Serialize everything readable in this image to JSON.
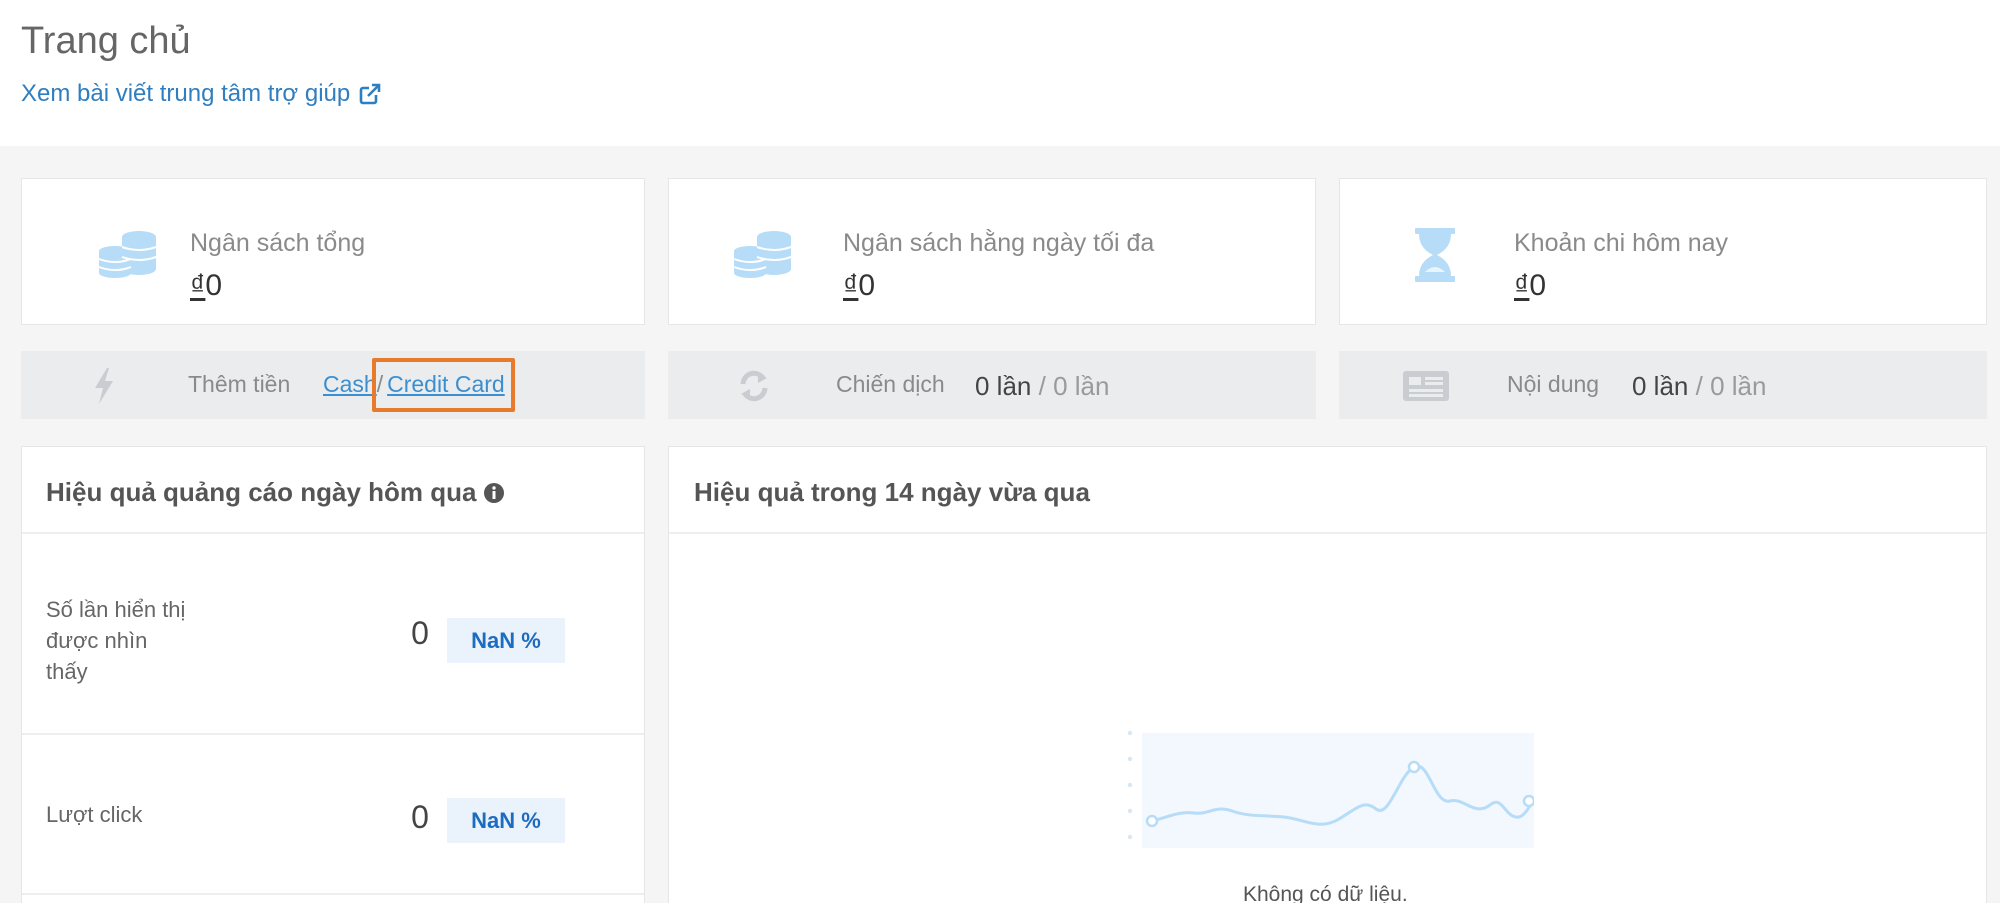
{
  "header": {
    "title": "Trang chủ",
    "help_link": "Xem bài viết trung tâm trợ giúp"
  },
  "stats": [
    {
      "label": "Ngân sách tổng",
      "currency": "₫",
      "value": "0",
      "icon": "coins-icon"
    },
    {
      "label": "Ngân sách hằng ngày tối đa",
      "currency": "₫",
      "value": "0",
      "icon": "coins-icon"
    },
    {
      "label": "Khoản chi hôm nay",
      "currency": "₫",
      "value": "0",
      "icon": "hourglass-icon"
    }
  ],
  "bars": {
    "topup": {
      "label": "Thêm tiền",
      "cash": "Cash",
      "sep": "/",
      "card": "Credit Card",
      "icon": "bolt-icon"
    },
    "campaign": {
      "label": "Chiến dịch",
      "value": "0 lần",
      "sep": "/ 0 lần",
      "icon": "refresh-icon"
    },
    "content": {
      "label": "Nội dung",
      "value": "0 lần",
      "sep": "/ 0 lần",
      "icon": "newspaper-icon"
    }
  },
  "yesterday_panel": {
    "title": "Hiệu quả quảng cáo ngày hôm qua",
    "metrics": [
      {
        "label": "Số lần hiển thị được nhìn thấy",
        "value": "0",
        "change": "NaN %"
      },
      {
        "label": "Lượt click",
        "value": "0",
        "change": "NaN %"
      }
    ]
  },
  "trend_panel": {
    "title": "Hiệu quả trong 14 ngày vừa qua",
    "empty_text": "Không có dữ liệu."
  },
  "colors": {
    "accent": "#2f7ec0",
    "icon_light": "#b6dcf7",
    "highlight": "#e87a2c",
    "badge_bg": "#eaf3fc",
    "badge_text": "#1c6cc0"
  }
}
